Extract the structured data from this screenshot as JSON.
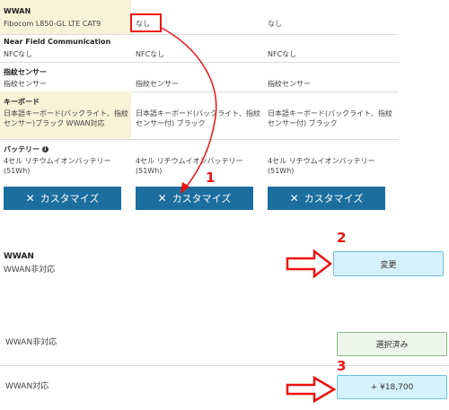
{
  "spec_rows": [
    {
      "heading": "WWAN",
      "values": [
        "Fibocom L850-GL LTE CAT9",
        "なし",
        "なし"
      ]
    },
    {
      "heading": "Near Field Communication",
      "values": [
        "NFCなし",
        "NFCなし",
        "NFCなし"
      ]
    },
    {
      "heading": "指紋センサー",
      "values": [
        "指紋センサー",
        "指紋センサー",
        "指紋センサー"
      ]
    },
    {
      "heading": "キーボード",
      "values": [
        "日本語キーボード(バックライト、指紋センサー)ブラック WWAN対応",
        "日本語キーボード(バックライト、指紋センサー付) ブラック",
        "日本語キーボード(バックライト、指紋センサー付) ブラック"
      ]
    },
    {
      "heading": "バッテリー",
      "heading_icon": "info-icon",
      "values": [
        "4セル リチウムイオンバッテリー (51Wh)",
        "4セル リチウムイオンバッテリー (51Wh)",
        "4セル リチウムイオンバッテリー (51Wh)"
      ]
    }
  ],
  "customize_buttons": [
    "カスタマイズ",
    "カスタマイズ",
    "カスタマイズ"
  ],
  "customize_icon": "tools-icon",
  "wwan_section": {
    "title": "WWAN",
    "current": "WWAN非対応",
    "change_button": "変更"
  },
  "options": [
    {
      "label": "WWAN非対応",
      "button": "選択済み"
    },
    {
      "label": "WWAN対応",
      "button": "+ ¥18,700"
    }
  ],
  "annotations": [
    "1",
    "2",
    "3"
  ],
  "colors": {
    "highlight": "#f6f3d6",
    "customize_button": "#1c6e9f",
    "annotation_red": "#e11111",
    "option_blue": "#d5f1fb",
    "option_green": "#eef5ec"
  }
}
